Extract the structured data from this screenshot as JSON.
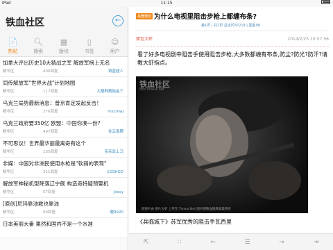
{
  "status_bar": {
    "carrier": "iPad",
    "time": "11:15"
  },
  "sidebar": {
    "site_title": "铁血社区",
    "back_icon": "back-arrow-icon",
    "tabs": [
      {
        "label": "热贴",
        "icon": "hot-icon",
        "active": true
      },
      {
        "label": "搜索",
        "icon": "search-icon",
        "active": false
      },
      {
        "label": "版块",
        "icon": "forum-icon",
        "active": false
      },
      {
        "label": "书签",
        "icon": "bookmark-icon",
        "active": false
      },
      {
        "label": "用户",
        "icon": "user-icon",
        "active": false
      }
    ],
    "posts": [
      {
        "title": "加拿大评出历史10大猜战之军 解放军榜上无名",
        "forum": "精华区",
        "replies": "400回复",
        "author": "铜蓝超人"
      },
      {
        "title": "同传解放军\"世界大战\"计划地图",
        "forum": "精华区",
        "replies": "117回复",
        "author": "大耀鲜筋独金三"
      },
      {
        "title": "乌克兰局势最新消息：普京肯定发起反击！",
        "forum": "精华区",
        "replies": "276回复",
        "author": "mscmwj"
      },
      {
        "title": "乌克兰政府要350亿 欧盟：中国你凑一份?",
        "forum": "精华区",
        "replies": "497回复",
        "author": "往云香腮"
      },
      {
        "title": "不可思议！世界最华丽最离奇有这个",
        "forum": "精华区",
        "replies": "135回复",
        "author": "亲亲武士马"
      },
      {
        "title": "非媒：中国对非洲民使用水枪是\"软弱的表现\"",
        "forum": "精华区",
        "replies": "211回复",
        "author": "1GSHGD"
      },
      {
        "title": "解放军神秘机型降落辽宁舰 构造奇特疑预警机",
        "forum": "精华区",
        "replies": "57回复",
        "author": "jiwuy"
      },
      {
        "title": "[原创]尼玛靠油救也靠油",
        "forum": "精华区",
        "replies": "90回复",
        "author": "暖8920"
      },
      {
        "title": "日本美丽大番 果然和国内不是一个水准",
        "forum": "",
        "replies": "",
        "author": ""
      }
    ]
  },
  "article": {
    "badge": "兵器博览",
    "title": "为什么电视里阻击步枪上都缠布条?",
    "stats": "第1页 | 共1页  总访问37219 | 回复98",
    "author": "蛋包大虾",
    "date": "2014/2/25 10:57:56",
    "body": "看了好多电视剧中阻击手使用阻击步枪,大多数都缠有布条,防尘?防光?防汗?请教大虾指点。",
    "photo_watermark": "铁血社区",
    "photo_watermark_url": "bbs.tiexue.net",
    "photo_caption_overlay": "前图片由 图片大虾 上传至 Tiexue.Net 图片图铁血图库收集所有",
    "photo_caption": "《兵临城下》苏军优秀的阻击手瓦西里"
  },
  "bottom_bar": {
    "icons": [
      "share-icon",
      "grid-icon",
      "prev-page-icon",
      "page-menu-icon",
      "next-page-icon",
      "last-page-icon"
    ]
  }
}
